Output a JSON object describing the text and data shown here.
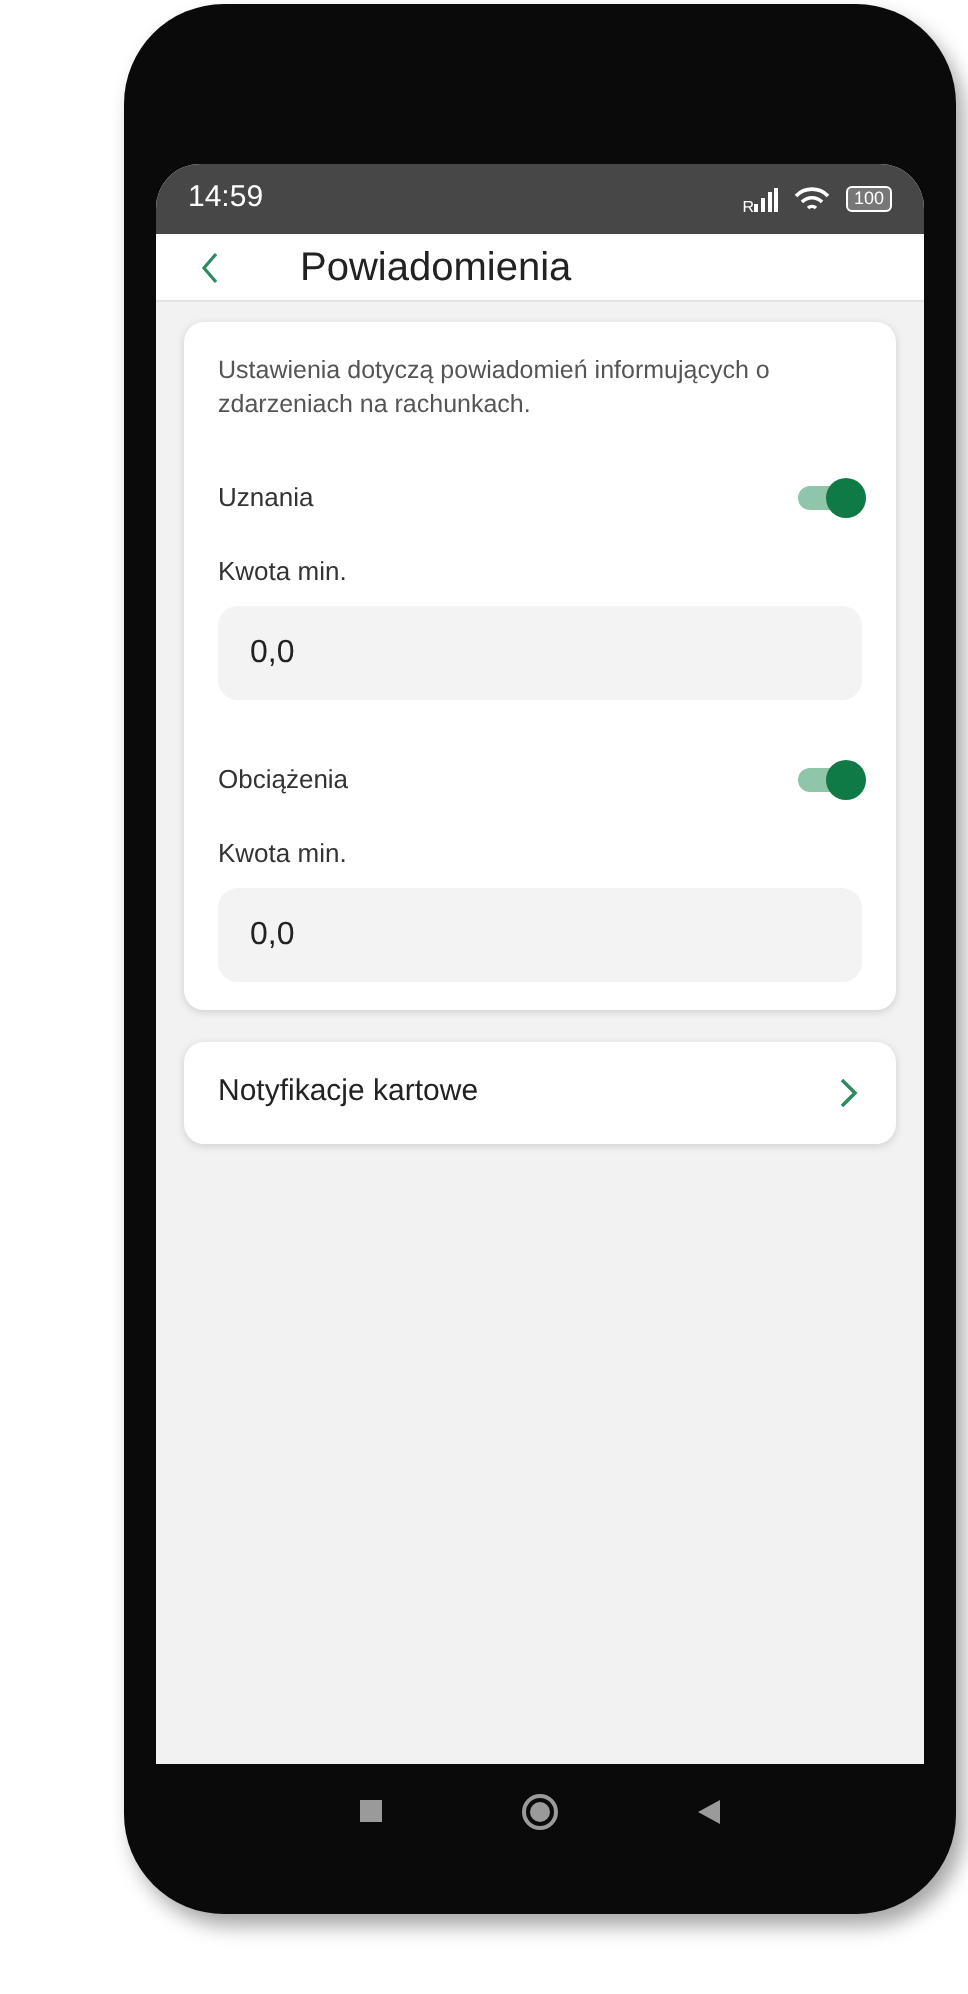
{
  "status_bar": {
    "time": "14:59",
    "signal_label": "R",
    "battery": "100"
  },
  "header": {
    "title": "Powiadomienia"
  },
  "settings_card": {
    "description": "Ustawienia dotyczą powiadomień informujących o zdarzeniach na rachunkach.",
    "sections": [
      {
        "label": "Uznania",
        "on": true,
        "field_label": "Kwota min.",
        "value": "0,0"
      },
      {
        "label": "Obciążenia",
        "on": true,
        "field_label": "Kwota min.",
        "value": "0,0"
      }
    ]
  },
  "links": [
    {
      "label": "Notyfikacje kartowe"
    }
  ]
}
